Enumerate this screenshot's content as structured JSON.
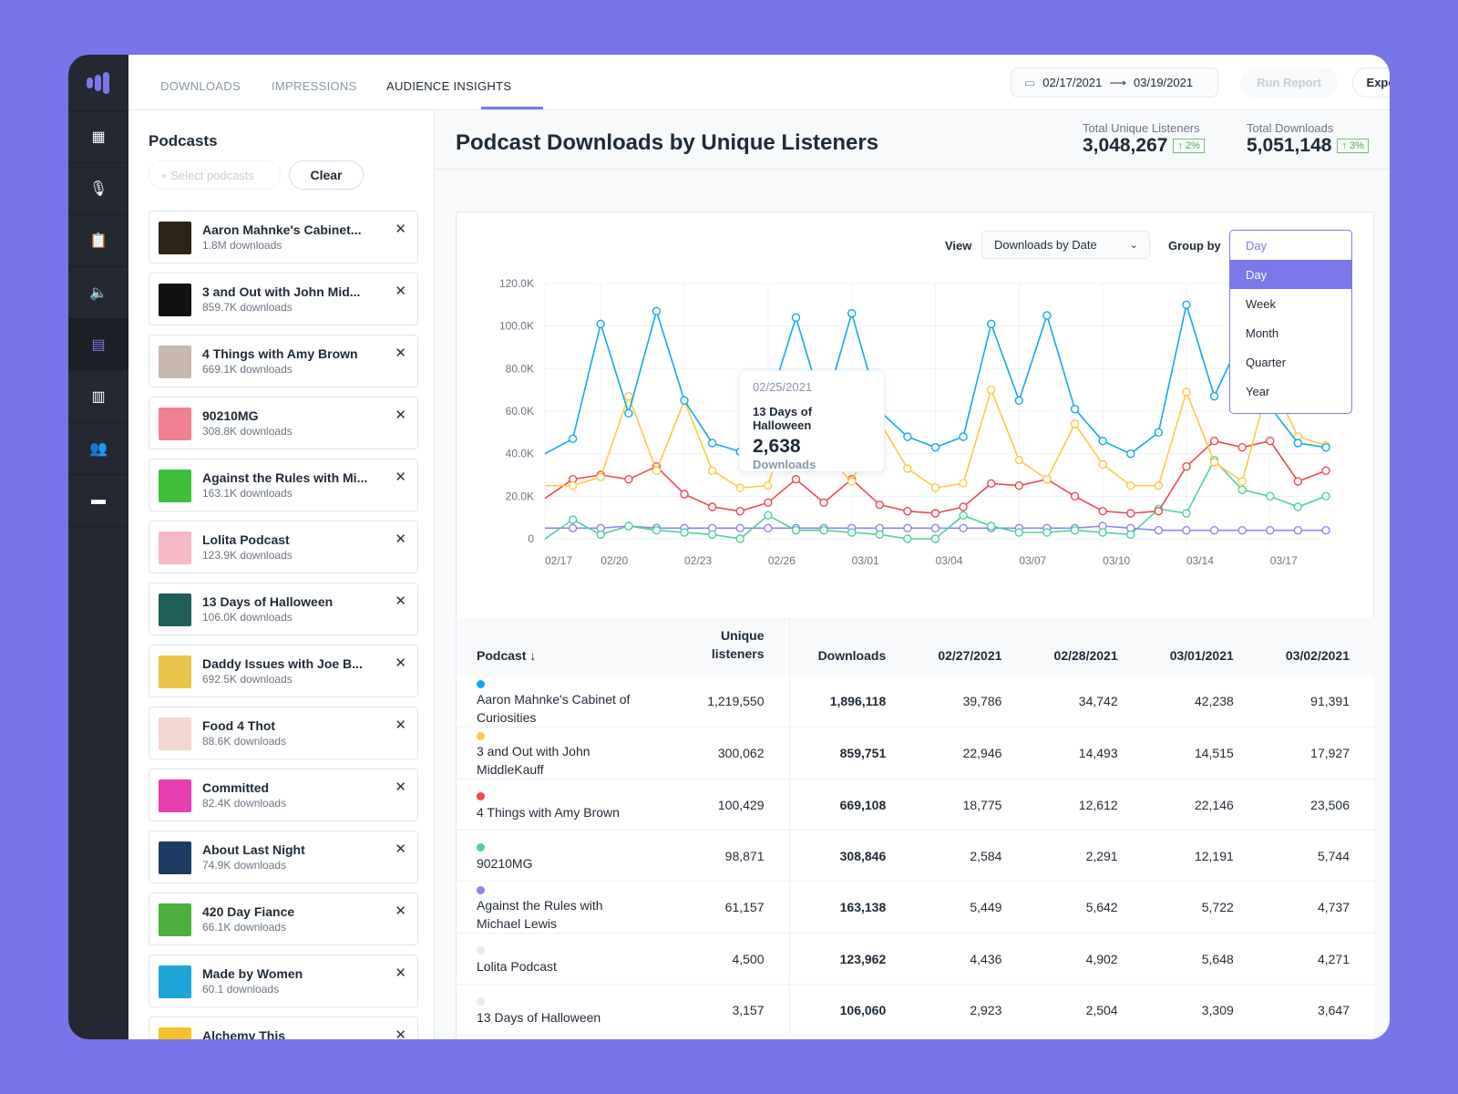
{
  "nav": {
    "tabs": [
      {
        "label": "DOWNLOADS"
      },
      {
        "label": "IMPRESSIONS"
      },
      {
        "label": "AUDIENCE INSIGHTS",
        "active": true
      }
    ],
    "date_start": "02/17/2021",
    "date_end": "03/19/2021",
    "run_report": "Run Report",
    "export": "Export"
  },
  "rail": {
    "icons": [
      "dashboard-icon",
      "microphone-icon",
      "clipboard-icon",
      "speaker-icon",
      "calendar-icon",
      "bar-chart-icon",
      "users-icon",
      "store-icon"
    ],
    "active": "calendar-icon"
  },
  "left": {
    "title": "Podcasts",
    "select_placeholder": "+ Select podcasts",
    "clear": "Clear",
    "podcasts": [
      {
        "name": "Aaron Mahnke's Cabinet...",
        "downloads": "1.8M downloads",
        "color": "#2b2417"
      },
      {
        "name": "3 and Out with John Mid...",
        "downloads": "859.7K downloads",
        "color": "#111111"
      },
      {
        "name": "4 Things with Amy Brown",
        "downloads": "669.1K downloads",
        "color": "#c9b8b0"
      },
      {
        "name": "90210MG",
        "downloads": "308.8K downloads",
        "color": "#f07f8f"
      },
      {
        "name": "Against the Rules with Mi...",
        "downloads": "163.1K downloads",
        "color": "#3fbf3a"
      },
      {
        "name": "Lolita Podcast",
        "downloads": "123.9K downloads",
        "color": "#f6b8c4"
      },
      {
        "name": "13 Days of Halloween",
        "downloads": "106.0K downloads",
        "color": "#1f5f5a"
      },
      {
        "name": "Daddy Issues with Joe B...",
        "downloads": "692.5K downloads",
        "color": "#e8c24a"
      },
      {
        "name": "Food 4 Thot",
        "downloads": "88.6K downloads",
        "color": "#f3d6cf"
      },
      {
        "name": "Committed",
        "downloads": "82.4K downloads",
        "color": "#e63fb0"
      },
      {
        "name": "About Last Night",
        "downloads": "74.9K downloads",
        "color": "#1e3b63"
      },
      {
        "name": "420 Day Fiance",
        "downloads": "66.1K downloads",
        "color": "#4caf3e"
      },
      {
        "name": "Made by Women",
        "downloads": "60.1 downloads",
        "color": "#1fa6d9"
      },
      {
        "name": "Alchemy This",
        "downloads": "",
        "color": "#f5c22b"
      }
    ]
  },
  "main": {
    "title": "Podcast Downloads by Unique Listeners",
    "stats": [
      {
        "label": "Total Unique Listeners",
        "value": "3,048,267",
        "change": "↑ 2%"
      },
      {
        "label": "Total Downloads",
        "value": "5,051,148",
        "change": "↑ 3%"
      }
    ],
    "view_label": "View",
    "view_value": "Downloads by Date",
    "group_label": "Group by",
    "group_value": "Day",
    "group_options": [
      "Day",
      "Week",
      "Month",
      "Quarter",
      "Year"
    ],
    "tooltip": {
      "date": "02/25/2021",
      "podcast": "13 Days of Halloween",
      "value": "2,638",
      "unit": "Downloads"
    }
  },
  "chart_data": {
    "type": "line",
    "ylim": [
      0,
      120000
    ],
    "y_ticks": [
      "0",
      "20.0K",
      "40.0K",
      "60.0K",
      "80.0K",
      "100.0K",
      "120.0K"
    ],
    "x_ticks": [
      {
        "label": "02/17",
        "index": 0
      },
      {
        "label": "02/20",
        "index": 2
      },
      {
        "label": "02/23",
        "index": 5
      },
      {
        "label": "02/26",
        "index": 8
      },
      {
        "label": "03/01",
        "index": 11
      },
      {
        "label": "03/04",
        "index": 14
      },
      {
        "label": "03/07",
        "index": 17
      },
      {
        "label": "03/10",
        "index": 20
      },
      {
        "label": "03/14",
        "index": 23
      },
      {
        "label": "03/17",
        "index": 26
      }
    ],
    "grid": true,
    "series": [
      {
        "color": "#12a8f0",
        "values": [
          40,
          47,
          101,
          59,
          107,
          65,
          45,
          41,
          62,
          104,
          60,
          106,
          60,
          48,
          43,
          48,
          101,
          65,
          105,
          61,
          46,
          40,
          50,
          110,
          67,
          95,
          62,
          45,
          43
        ]
      },
      {
        "color": "#fec944",
        "values": [
          25,
          25,
          29,
          67,
          32,
          65,
          32,
          24,
          25,
          70,
          40,
          27,
          55,
          33,
          24,
          26,
          70,
          37,
          28,
          54,
          35,
          25,
          25,
          69,
          36,
          27,
          75,
          48,
          44
        ]
      },
      {
        "color": "#f1474f",
        "values": [
          19,
          28,
          30,
          28,
          34,
          21,
          15,
          13,
          17,
          28,
          17,
          28,
          16,
          13,
          12,
          15,
          26,
          25,
          28,
          20,
          13,
          12,
          13,
          34,
          46,
          43,
          46,
          27,
          32
        ]
      },
      {
        "color": "#4fd19a",
        "values": [
          0,
          9,
          2,
          6,
          4,
          3,
          2,
          0,
          11,
          4,
          4,
          3,
          2,
          0,
          0,
          11,
          6,
          3,
          3,
          4,
          3,
          2,
          14,
          12,
          37,
          23,
          20,
          15,
          20
        ]
      },
      {
        "color": "#8c86f0",
        "values": [
          5,
          5,
          5,
          6,
          5,
          5,
          5,
          5,
          5,
          5,
          5,
          5,
          5,
          5,
          5,
          5,
          5,
          5,
          5,
          5,
          6,
          5,
          4,
          4,
          4,
          4,
          4,
          4,
          4
        ]
      }
    ]
  },
  "table": {
    "headers": [
      "Podcast ↓",
      "Unique listeners",
      "Downloads",
      "02/27/2021",
      "02/28/2021",
      "03/01/2021",
      "03/02/2021"
    ],
    "rows": [
      {
        "color": "#12a8f0",
        "name": "Aaron Mahnke's Cabinet of Curiosities",
        "cells": [
          "1,219,550",
          "1,896,118",
          "39,786",
          "34,742",
          "42,238",
          "91,391"
        ]
      },
      {
        "color": "#fec944",
        "name": "3 and Out with John MiddleKauff",
        "cells": [
          "300,062",
          "859,751",
          "22,946",
          "14,493",
          "14,515",
          "17,927"
        ]
      },
      {
        "color": "#f1474f",
        "name": "4 Things with Amy Brown",
        "cells": [
          "100,429",
          "669,108",
          "18,775",
          "12,612",
          "22,146",
          "23,506"
        ]
      },
      {
        "color": "#4fd19a",
        "name": "90210MG",
        "cells": [
          "98,871",
          "308,846",
          "2,584",
          "2,291",
          "12,191",
          "5,744"
        ]
      },
      {
        "color": "#8c86f0",
        "name": "Against the Rules with Michael Lewis",
        "cells": [
          "61,157",
          "163,138",
          "5,449",
          "5,642",
          "5,722",
          "4,737"
        ]
      },
      {
        "color": "#e6e9ed",
        "name": "Lolita Podcast",
        "cells": [
          "4,500",
          "123,962",
          "4,436",
          "4,902",
          "5,648",
          "4,271"
        ]
      },
      {
        "color": "#e6e9ed",
        "name": "13 Days of Halloween",
        "cells": [
          "3,157",
          "106,060",
          "2,923",
          "2,504",
          "3,309",
          "3,647"
        ]
      }
    ]
  }
}
